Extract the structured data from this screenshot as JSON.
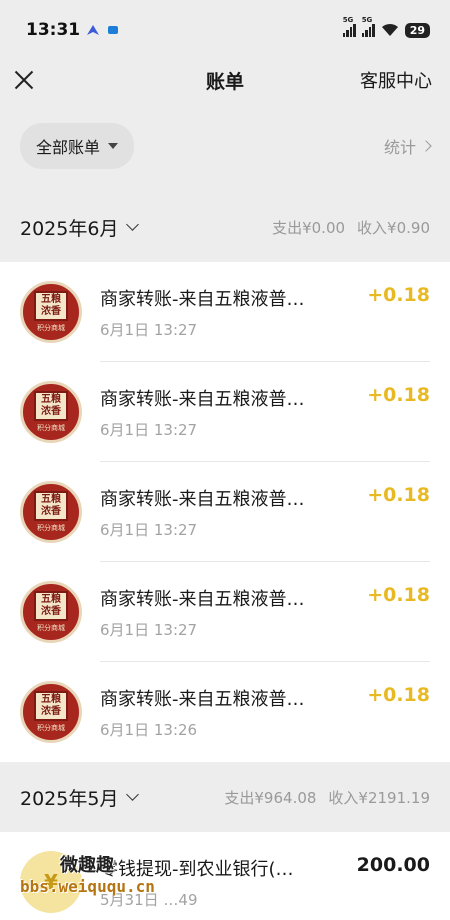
{
  "status_bar": {
    "time": "13:31",
    "sig1": "5G",
    "sig2": "5G",
    "battery": "29"
  },
  "nav": {
    "title": "账单",
    "service_label": "客服中心"
  },
  "filter": {
    "chip_label": "全部账单",
    "stats_label": "统计"
  },
  "months": [
    {
      "title": "2025年6月",
      "expense": "支出¥0.00",
      "income": "收入¥0.90",
      "transactions": [
        {
          "title": "商家转账-来自五粮液普…",
          "time": "6月1日 13:27",
          "amount": "+0.18"
        },
        {
          "title": "商家转账-来自五粮液普…",
          "time": "6月1日 13:27",
          "amount": "+0.18"
        },
        {
          "title": "商家转账-来自五粮液普…",
          "time": "6月1日 13:27",
          "amount": "+0.18"
        },
        {
          "title": "商家转账-来自五粮液普…",
          "time": "6月1日 13:27",
          "amount": "+0.18"
        },
        {
          "title": "商家转账-来自五粮液普…",
          "time": "6月1日 13:26",
          "amount": "+0.18"
        }
      ]
    },
    {
      "title": "2025年5月",
      "expense": "支出¥964.08",
      "income": "收入¥2191.19",
      "transactions": [
        {
          "title": "零钱提现-到农业银行(…",
          "time": "5月31日 …49",
          "amount": "200.00"
        }
      ]
    }
  ],
  "merchant_avatar": {
    "seal_line1": "五粮",
    "seal_line2": "浓香",
    "sub": "积分商城"
  },
  "watermark": {
    "line1": "微趣趣",
    "line2": "bbs.weiququ.cn"
  },
  "colors": {
    "income_amount": "#e9b923",
    "background": "#ededed",
    "brand_red": "#a7271f"
  }
}
